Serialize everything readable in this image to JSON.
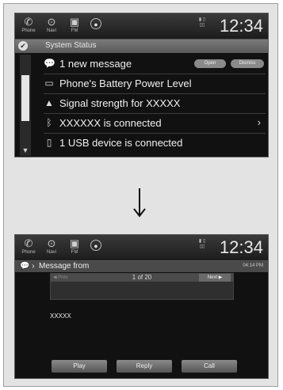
{
  "status_bar": {
    "icons": [
      {
        "icon": "phone-icon",
        "label": "Phone"
      },
      {
        "icon": "navi-icon",
        "label": "Navi"
      },
      {
        "icon": "fm-icon",
        "label": "FM"
      },
      {
        "icon": "circle-icon",
        "label": ""
      }
    ],
    "clock": "12:34"
  },
  "screen1": {
    "section_title": "System Status",
    "rows": [
      {
        "icon": "message-icon",
        "text": "1 new message",
        "buttons": [
          "Open",
          "Dismiss"
        ]
      },
      {
        "icon": "battery-icon",
        "text": "Phone's Battery Power Level"
      },
      {
        "icon": "signal-icon",
        "text": "Signal strength for XXXXX"
      },
      {
        "icon": "bluetooth-icon",
        "text": "XXXXXX  is connected"
      },
      {
        "icon": "usb-icon",
        "text": "1 USB device is connected"
      }
    ]
  },
  "screen2": {
    "header_title": "Message from",
    "time": "04:14 PM",
    "prev_label": "Prev",
    "page": "1 of 20",
    "next_label": "Next",
    "sender": "XXXXX",
    "buttons": [
      "Play",
      "Reply",
      "Call"
    ]
  }
}
